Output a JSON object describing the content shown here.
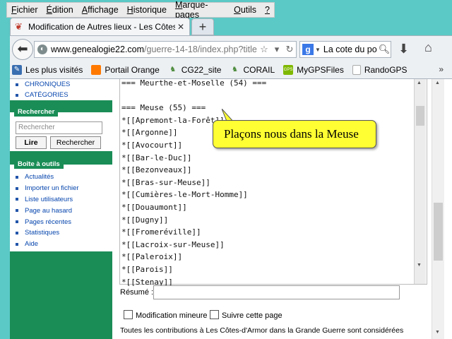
{
  "menubar": {
    "items": [
      {
        "label_u": "F",
        "label_rest": "ichier"
      },
      {
        "label_u": "É",
        "label_rest": "dition"
      },
      {
        "label_u": "A",
        "label_rest": "ffichage"
      },
      {
        "label_u": "H",
        "label_rest": "istorique"
      },
      {
        "label_u": "M",
        "label_rest": "arque-pages"
      },
      {
        "label_u": "O",
        "label_rest": "utils"
      },
      {
        "label_u": "?",
        "label_rest": ""
      }
    ]
  },
  "tab": {
    "title": "Modification de Autres lieux - Les Côtes-...",
    "close": "✕",
    "new": "+"
  },
  "navbar": {
    "url_host": "www.genealogie22.com",
    "url_path": "/guerre-14-18/index.php?title",
    "search_text": "La cote du po",
    "search_engine": "g"
  },
  "bookmarks": [
    {
      "label": "Les plus visités",
      "icon": "most-visited-icon",
      "color": "#3a6fb0"
    },
    {
      "label": "Portail Orange",
      "icon": "orange-icon",
      "color": "#ff7900"
    },
    {
      "label": "CG22_site",
      "icon": "cg22-icon",
      "color": "#4a8a3a"
    },
    {
      "label": "CORAIL",
      "icon": "corail-icon",
      "color": "#4a8a3a"
    },
    {
      "label": "MyGPSFiles",
      "icon": "mygps-icon",
      "color": "#7fb800"
    },
    {
      "label": "RandoGPS",
      "icon": "page-icon",
      "color": "#ffffff"
    }
  ],
  "sidebar": {
    "top_links": [
      "CHRONIQUES",
      "CATÉGORIES"
    ],
    "search": {
      "heading": "Rechercher",
      "placeholder": "Rechercher",
      "read_button": "Lire",
      "search_button": "Rechercher"
    },
    "toolbox": {
      "heading": "Boîte à outils",
      "links": [
        "Actualités",
        "Importer un fichier",
        "Liste utilisateurs",
        "Page au hasard",
        "Pages récentes",
        "Statistiques",
        "Aide"
      ]
    }
  },
  "editor": {
    "lines": [
      "=== Meurthe-et-Moselle (54) ===",
      "",
      "=== Meuse (55) ===",
      "*[[Apremont-la-Forêt]]",
      "*[[Argonne]]",
      "*[[Avocourt]]",
      "*[[Bar-le-Duc]]",
      "*[[Bezonveaux]]",
      "*[[Bras-sur-Meuse]]",
      "*[[Cumières-le-Mort-Homme]]",
      "*[[Douaumont]]",
      "*[[Dugny]]",
      "*[[Fromeréville]]",
      "*[[Lacroix-sur-Meuse]]",
      "*[[Paleroix]]",
      "*[[Parois]]",
      "*[[Stenay]]"
    ]
  },
  "callout": {
    "text": "Plaçons nous dans la Meuse"
  },
  "form": {
    "summary_label": "Résumé :",
    "minor_edit_label": "Modification mineure",
    "watch_label": "Suivre cette page",
    "footer": "Toutes les contributions à Les Côtes-d'Armor dans la Grande Guerre sont considérées"
  }
}
